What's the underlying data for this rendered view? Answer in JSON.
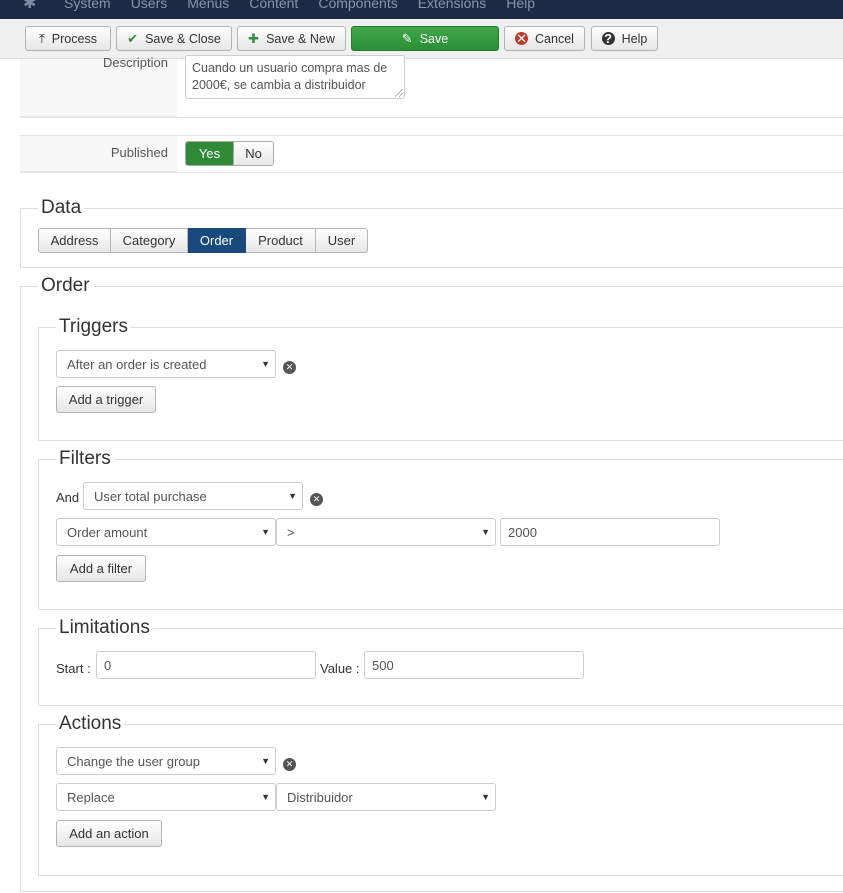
{
  "nav": {
    "logo_icon": "joomla-logo-icon",
    "items": [
      "System",
      "Users",
      "Menus",
      "Content",
      "Components",
      "Extensions",
      "Help"
    ]
  },
  "toolbar": {
    "process": "Process",
    "save_close": "Save & Close",
    "save_new": "Save & New",
    "save": "Save",
    "cancel": "Cancel",
    "help": "Help"
  },
  "form": {
    "description_label": "Description",
    "description_value": "Cuando un usuario compra mas de 2000€, se cambia a distribuidor",
    "published_label": "Published",
    "published_yes": "Yes",
    "published_no": "No",
    "published_value": "Yes"
  },
  "data_section": {
    "legend": "Data",
    "tabs": [
      "Address",
      "Category",
      "Order",
      "Product",
      "User"
    ],
    "active_tab": "Order"
  },
  "order_section": {
    "legend": "Order",
    "triggers": {
      "legend": "Triggers",
      "selected": "After an order is created",
      "add_button": "Add a trigger"
    },
    "filters": {
      "legend": "Filters",
      "and_label": "And",
      "filter_type": "User total purchase",
      "field": "Order amount",
      "operator": ">",
      "value": "2000",
      "add_button": "Add a filter"
    },
    "limitations": {
      "legend": "Limitations",
      "start_label": "Start :",
      "start_value": "0",
      "value_label": "Value :",
      "value_value": "500"
    },
    "actions": {
      "legend": "Actions",
      "action_type": "Change the user group",
      "mode": "Replace",
      "group": "Distribuidor",
      "add_button": "Add an action"
    }
  },
  "colors": {
    "nav_bg": "#1b2a45",
    "save_green": "#2f8a37",
    "active_tab": "#184a7e"
  }
}
